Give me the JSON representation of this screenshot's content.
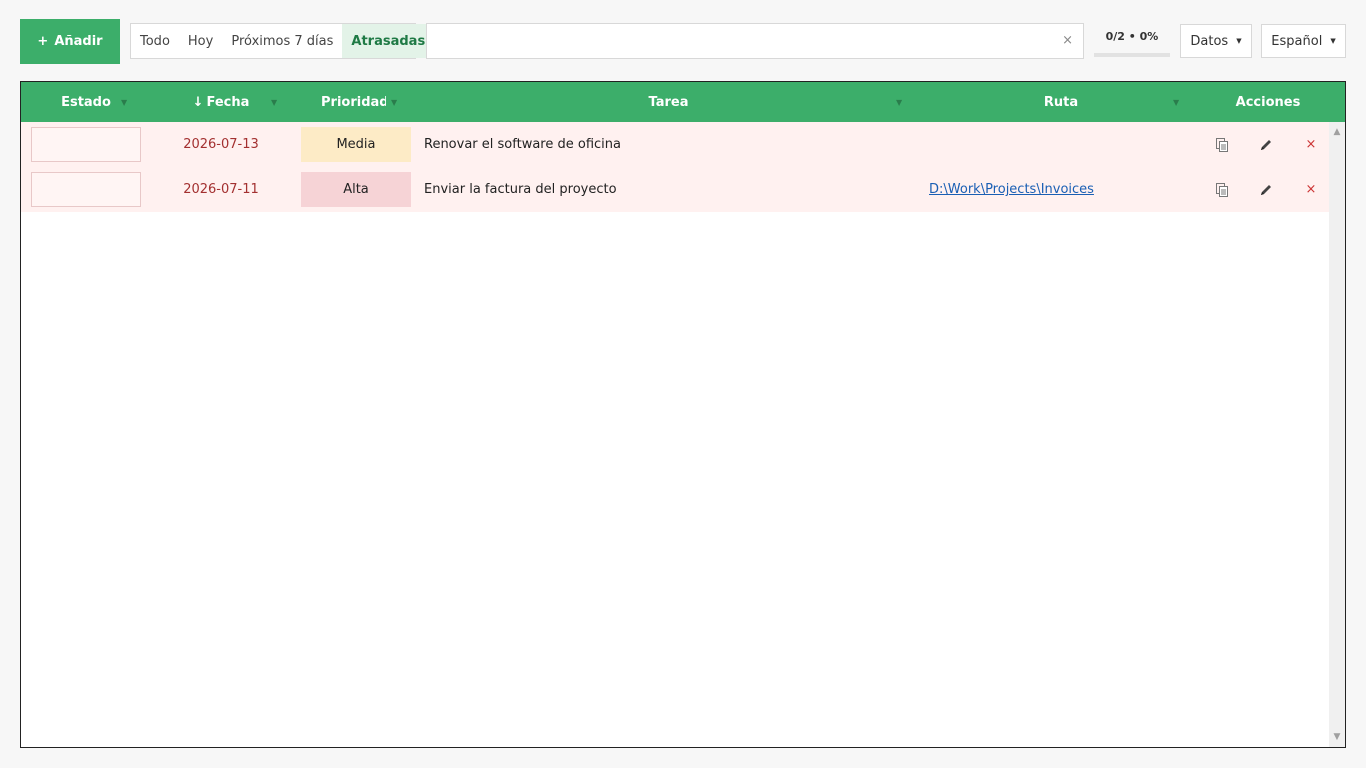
{
  "toolbar": {
    "add_label": "Añadir",
    "add_icon": "+",
    "filters": [
      "Todo",
      "Hoy",
      "Próximos 7 días",
      "Atrasadas"
    ],
    "active_filter": "Atrasadas",
    "search_value": "",
    "search_clear": "×",
    "progress_text": "0/2 • 0%",
    "progress_fraction": 0,
    "data_menu": "Datos",
    "language_menu": "Español"
  },
  "table": {
    "columns": {
      "estado": "Estado",
      "fecha": "Fecha",
      "fecha_sort": "↓",
      "prioridad": "Prioridad",
      "tarea": "Tarea",
      "ruta": "Ruta",
      "acciones": "Acciones"
    },
    "rows": [
      {
        "date": "2026-07-13",
        "priority": "Media",
        "task": "Renovar el software de oficina",
        "route": ""
      },
      {
        "date": "2026-07-11",
        "priority": "Alta",
        "task": "Enviar la factura del proyecto",
        "route": "D:\\Work\\Projects\\Invoices"
      }
    ],
    "delete_glyph": "×"
  },
  "colors": {
    "accent": "#3cae6a",
    "overdue_row": "#fff1f0",
    "overdue_date": "#a33030",
    "priority_media": "#fdebc6",
    "priority_alta": "#f6d3d6",
    "link": "#1a5fb4"
  },
  "icons": {
    "copy": "copy-icon",
    "edit": "pencil-icon",
    "delete": "close-icon"
  }
}
